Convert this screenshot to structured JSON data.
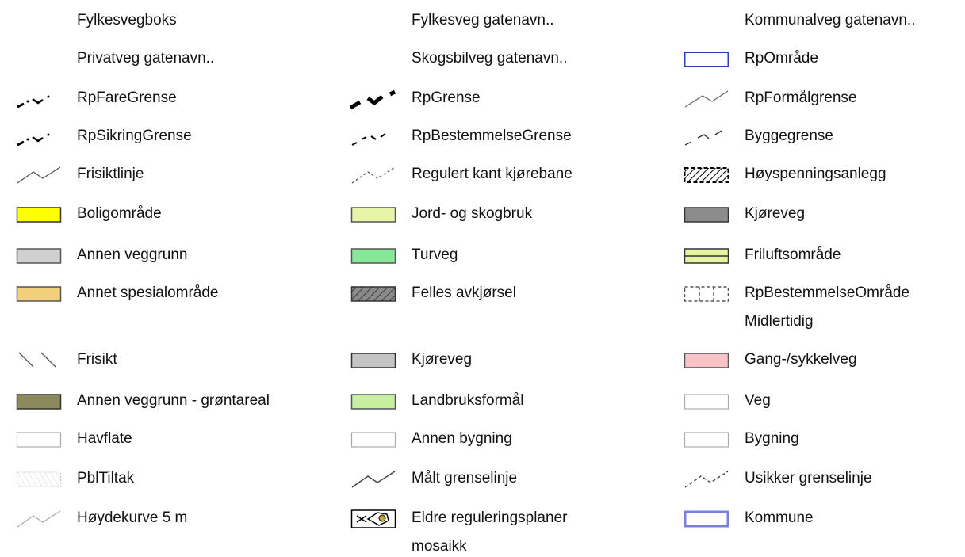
{
  "legend": {
    "items": [
      {
        "label": "Fylkesvegboks",
        "icon": "blank"
      },
      {
        "label": "Fylkesveg gatenavn..",
        "icon": "blank"
      },
      {
        "label": "Kommunalveg gatenavn..",
        "icon": "blank"
      },
      {
        "label": "Privatveg gatenavn..",
        "icon": "blank"
      },
      {
        "label": "Skogsbilveg gatenavn..",
        "icon": "blank"
      },
      {
        "label": "RpOmråde",
        "icon": "box-outline",
        "color": "#2a3fb8"
      },
      {
        "label": "RpFareGrense",
        "icon": "dash-dot-line"
      },
      {
        "label": "RpGrense",
        "icon": "thick-dash-line"
      },
      {
        "label": "RpFormålgrense",
        "icon": "thin-line",
        "color": "#666666"
      },
      {
        "label": "RpSikringGrense",
        "icon": "dash-dot-line"
      },
      {
        "label": "RpBestemmelseGrense",
        "icon": "dashed-line"
      },
      {
        "label": "Byggegrense",
        "icon": "dashed-line"
      },
      {
        "label": "Frisiktlinje",
        "icon": "thin-line",
        "color": "#555555"
      },
      {
        "label": "Regulert kant kjørebane",
        "icon": "dotted-line"
      },
      {
        "label": "Høyspenningsanlegg",
        "icon": "hatched-dashed-box"
      },
      {
        "label": "Boligområde",
        "icon": "filled-box",
        "color": "#ffff00"
      },
      {
        "label": "Jord- og skogbruk",
        "icon": "filled-box",
        "color": "#e6f5a8"
      },
      {
        "label": "Kjøreveg",
        "icon": "filled-box",
        "color": "#8c8c8c"
      },
      {
        "label": "Annen veggrunn",
        "icon": "filled-box",
        "color": "#d0d0d0"
      },
      {
        "label": "Turveg",
        "icon": "filled-box",
        "color": "#88e89a"
      },
      {
        "label": "Friluftsområde",
        "icon": "striped-box",
        "color": "#e8f5a0"
      },
      {
        "label": "Annet spesialområde",
        "icon": "filled-box",
        "color": "#f2cf7a"
      },
      {
        "label": "Felles avkjørsel",
        "icon": "hatched-box",
        "color": "#707070"
      },
      {
        "label": "RpBestemmelseOmråde",
        "label2": "Midlertidig",
        "icon": "dashed-box"
      },
      {
        "label": "Frisikt",
        "icon": "double-slash"
      },
      {
        "label": "Kjøreveg",
        "icon": "filled-box",
        "color": "#c4c4c4"
      },
      {
        "label": "Gang-/sykkelveg",
        "icon": "filled-box",
        "color": "#f8c3c7"
      },
      {
        "label": "Annen veggrunn - grøntareal",
        "icon": "filled-box",
        "color": "#8c8a5c"
      },
      {
        "label": "Landbruksformål",
        "icon": "filled-box",
        "color": "#c6f0a0"
      },
      {
        "label": "Veg",
        "icon": "outline-box-light"
      },
      {
        "label": "Havflate",
        "icon": "outline-box-light"
      },
      {
        "label": "Annen bygning",
        "icon": "outline-box-light"
      },
      {
        "label": "Bygning",
        "icon": "outline-box-light"
      },
      {
        "label": "PblTiltak",
        "icon": "faint-hatch-box"
      },
      {
        "label": "Målt grenselinje",
        "icon": "thin-line",
        "color": "#444444"
      },
      {
        "label": "Usikker grenselinje",
        "icon": "dashed-line"
      },
      {
        "label": "Høydekurve 5 m",
        "icon": "thin-line",
        "color": "#aaaaaa"
      },
      {
        "label": "Eldre reguleringsplaner",
        "label2": "mosaikk",
        "icon": "mosaic-box"
      },
      {
        "label": "Kommune",
        "icon": "box-outline-blue",
        "color": "#7a7fe0"
      }
    ]
  }
}
